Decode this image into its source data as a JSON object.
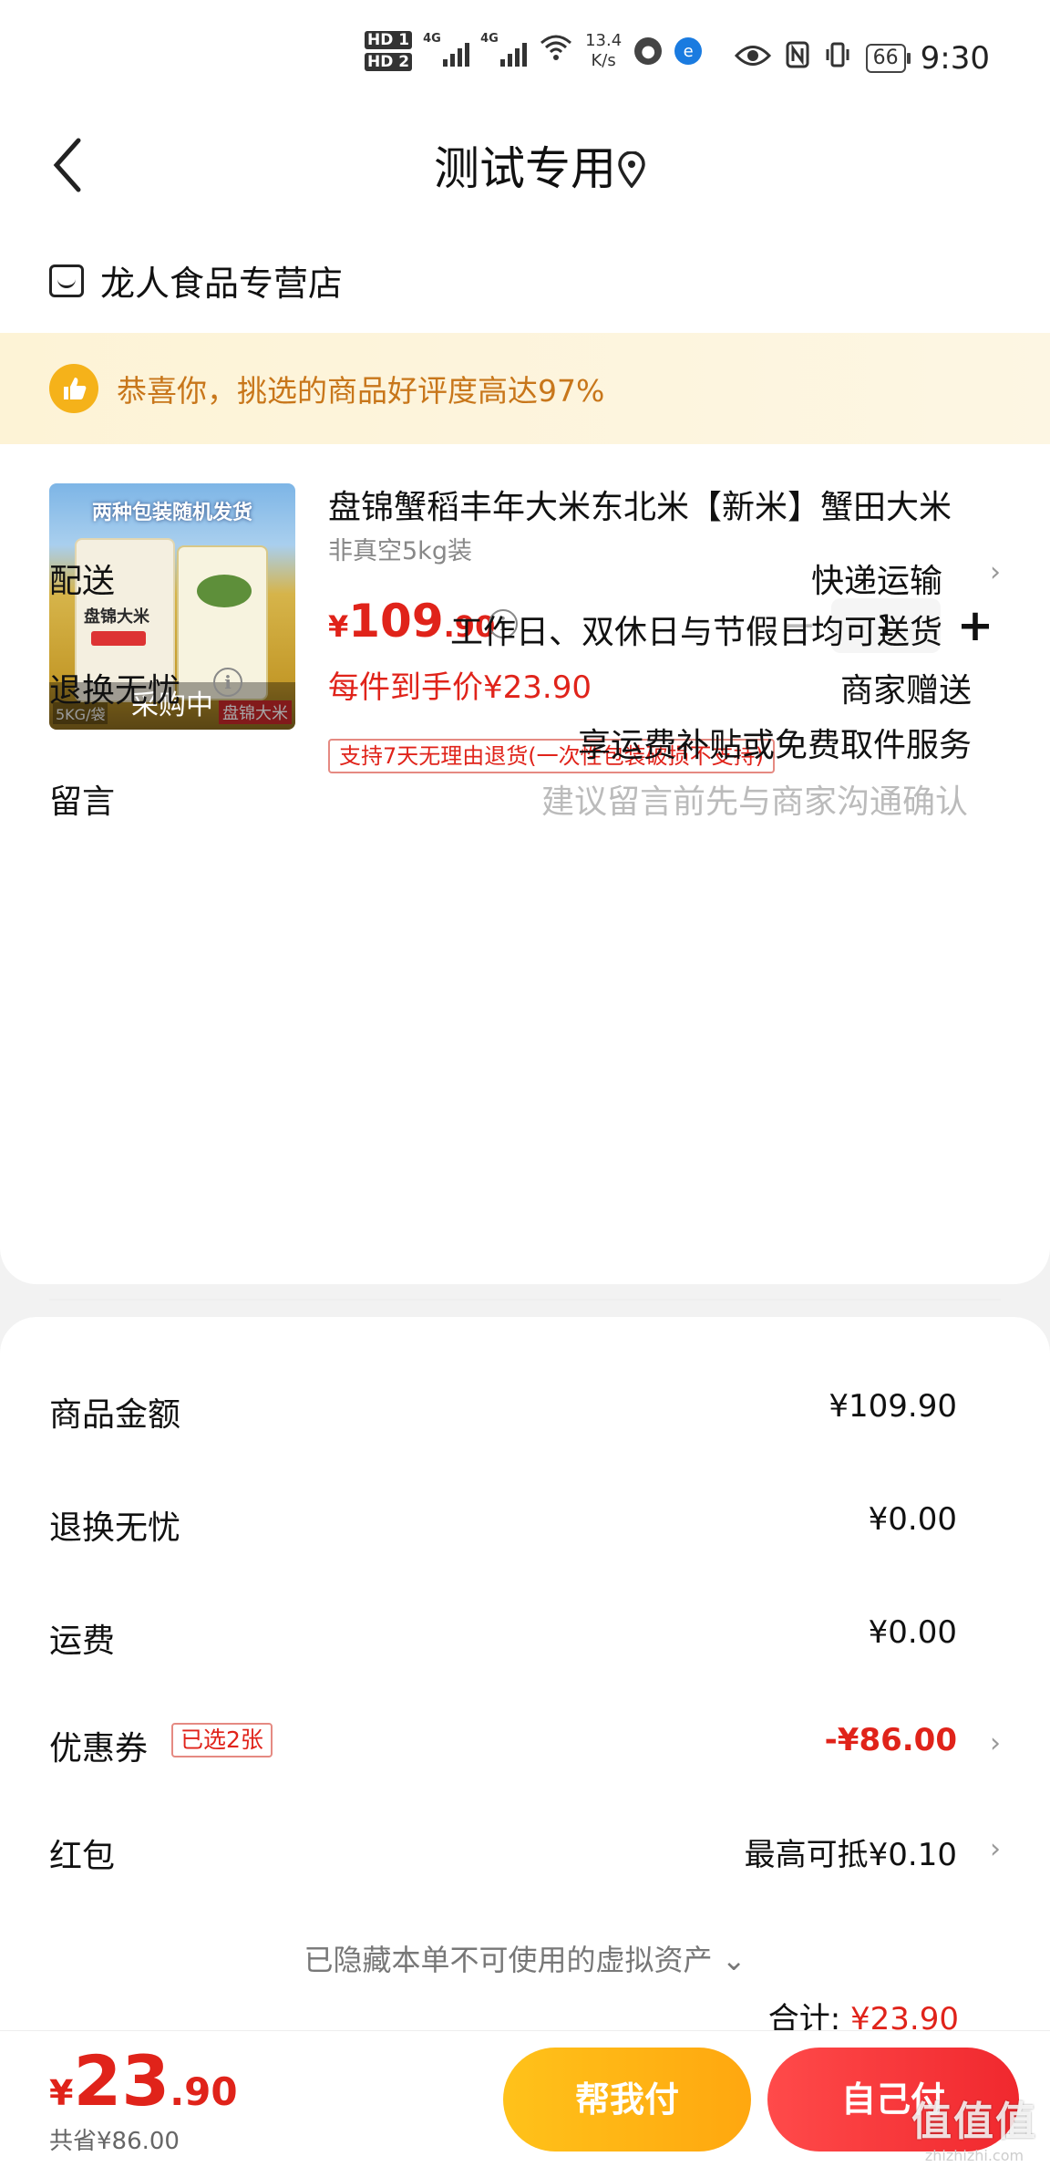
{
  "status_bar": {
    "sim1": "HD 1",
    "sim2": "HD 2",
    "net1": "4G",
    "net2": "4G",
    "speed_value": "13.4",
    "speed_unit": "K/s",
    "battery": "66",
    "time": "9:30"
  },
  "header": {
    "title": "测试专用",
    "back_icon": "chevron-left-icon",
    "location_icon": "location-pin-icon"
  },
  "store": {
    "name": "龙人食品专营店",
    "icon": "store-icon"
  },
  "banner": {
    "text": "恭喜你，挑选的商品好评度高达97%",
    "icon": "thumbs-up-icon"
  },
  "product": {
    "image_top_text": "两种包装随机发货",
    "image_bag_label": "盘锦大米",
    "image_weight": "5KG/袋",
    "image_brand": "盘锦大米",
    "status_overlay": "采购中",
    "name": "盘锦蟹稻丰年大米东北米【新米】蟹田大米",
    "spec": "非真空5kg装",
    "price_currency": "¥",
    "price_integer": "109",
    "price_decimal": ".90",
    "unit_price": "每件到手价¥23.90",
    "quantity": "1",
    "return_tag": "支持7天无理由退货(一次性包装破损不支持)"
  },
  "delivery": {
    "label": "配送",
    "method": "快递运输",
    "note": "工作日、双休日与节假日均可送货"
  },
  "return_worry_free": {
    "label": "退换无忧",
    "value": "商家赠送",
    "note": "享运费补贴或免费取件服务"
  },
  "message": {
    "label": "留言",
    "placeholder": "建议留言前先与商家沟通确认"
  },
  "summary": {
    "goods_amount_label": "商品金额",
    "goods_amount": "¥109.90",
    "return_label": "退换无忧",
    "return_amount": "¥0.00",
    "shipping_label": "运费",
    "shipping_amount": "¥0.00",
    "coupon_label": "优惠券",
    "coupon_tag": "已选2张",
    "coupon_amount": "-¥86.00",
    "redpacket_label": "红包",
    "redpacket_value": "最高可抵¥0.10",
    "hidden_assets": "已隐藏本单不可使用的虚拟资产",
    "total_label": "合计:",
    "total_value": "¥23.90"
  },
  "bottom_bar": {
    "currency": "¥",
    "total_integer": "23",
    "total_decimal": ".90",
    "saved": "共省¥86.00",
    "help_pay": "帮我付",
    "self_pay": "自己付"
  },
  "watermark": {
    "main": "值值值",
    "sub": "zhizhizhi.com"
  },
  "colors": {
    "accent_red": "#e0231a",
    "accent_orange": "#ffb01a",
    "banner_text": "#c8761a"
  }
}
